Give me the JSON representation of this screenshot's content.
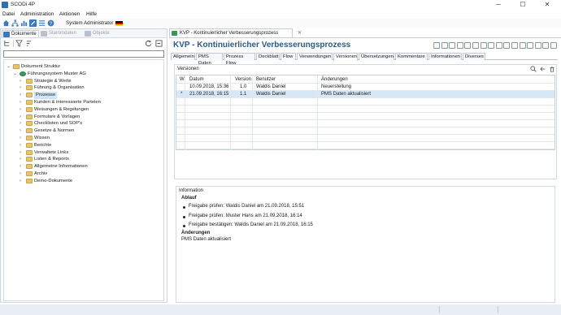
{
  "window": {
    "title": "SCODi 4P",
    "controls": {
      "minimize": "─",
      "maximize": "☐",
      "close": "✕"
    }
  },
  "menu": [
    "Datei",
    "Administration",
    "Aktionen",
    "Hilfe"
  ],
  "toolbar": {
    "user": "System Administrator",
    "flag": "de-flag-icon"
  },
  "left": {
    "tabs": [
      "Dokumente",
      "Stammdaten",
      "Objekte"
    ],
    "filter_value": "",
    "tree": [
      {
        "label": "Dokument Struktur",
        "level": 0,
        "expanded": true,
        "icon": "folder"
      },
      {
        "label": "Führungssystem Muster AG",
        "level": 1,
        "expanded": true,
        "icon": "system"
      },
      {
        "label": "Strategie & Werte",
        "level": 2,
        "icon": "folder"
      },
      {
        "label": "Führung & Organisation",
        "level": 2,
        "icon": "folder"
      },
      {
        "label": "Prozesse",
        "level": 2,
        "icon": "folder",
        "selected": true
      },
      {
        "label": "Kunden & interessierte Parteien",
        "level": 2,
        "icon": "folder"
      },
      {
        "label": "Weisungen & Regelungen",
        "level": 2,
        "icon": "folder"
      },
      {
        "label": "Formulare & Vorlagen",
        "level": 2,
        "icon": "folder"
      },
      {
        "label": "Checklisten und SOP's",
        "level": 2,
        "icon": "folder"
      },
      {
        "label": "Gesetze & Normen",
        "level": 2,
        "icon": "folder"
      },
      {
        "label": "Wissen",
        "level": 2,
        "icon": "folder"
      },
      {
        "label": "Berichte",
        "level": 2,
        "icon": "folder"
      },
      {
        "label": "Verwaltete Links",
        "level": 2,
        "icon": "folder"
      },
      {
        "label": "Listen & Reports",
        "level": 2,
        "icon": "folder"
      },
      {
        "label": "Allgemeine Informationen",
        "level": 2,
        "icon": "folder"
      },
      {
        "label": "Archiv",
        "level": 2,
        "icon": "folder"
      },
      {
        "label": "Demo-Dokumente",
        "level": 2,
        "icon": "folder"
      }
    ]
  },
  "doc": {
    "tab_label": "KVP - Kontinuierlicher Verbesserungsprozess",
    "title": "KVP - Kontinuierlicher Verbesserungsprozess",
    "subtabs": [
      "Allgemein",
      "PMS Daten",
      "Prozess Flow",
      "Deckblatt",
      "Flow",
      "Verwendungen",
      "Versionen",
      "Übersetzungen",
      "Kommentare",
      "Informationen",
      "Diverses"
    ],
    "active_subtab": "Versionen"
  },
  "versions": {
    "box_title": "Versionen",
    "columns": [
      "W",
      "Datum",
      "Version",
      "Benutzer",
      "Änderungen"
    ],
    "rows": [
      {
        "marker": "",
        "date": "10.09.2018, 15:36",
        "version": "1.0",
        "user": "Waldis Daniel",
        "change": "Neuerstellung"
      },
      {
        "marker": "*",
        "date": "21.09.2018, 16:15",
        "version": "1.1",
        "user": "Waldis Daniel",
        "change": "PMS Daten aktualisiert"
      }
    ]
  },
  "info": {
    "caption": "Information",
    "ablauf_heading": "Ablauf",
    "items": [
      "Freigabe prüfen: Waldis Daniel am 21.09.2018, 15:51",
      "Freigabe prüfen: Muster Hans am 21.09.2018, 16:14",
      "Freigabe bestätigen: Waldis Daniel am 21.09.2018, 16:15"
    ],
    "changes_heading": "Änderungen",
    "changes_text": "PMS Daten aktualisiert"
  },
  "colors": {
    "title_blue": "#2c5a8a",
    "selection": "#d6e8f8",
    "folder": "#e8c46a"
  }
}
